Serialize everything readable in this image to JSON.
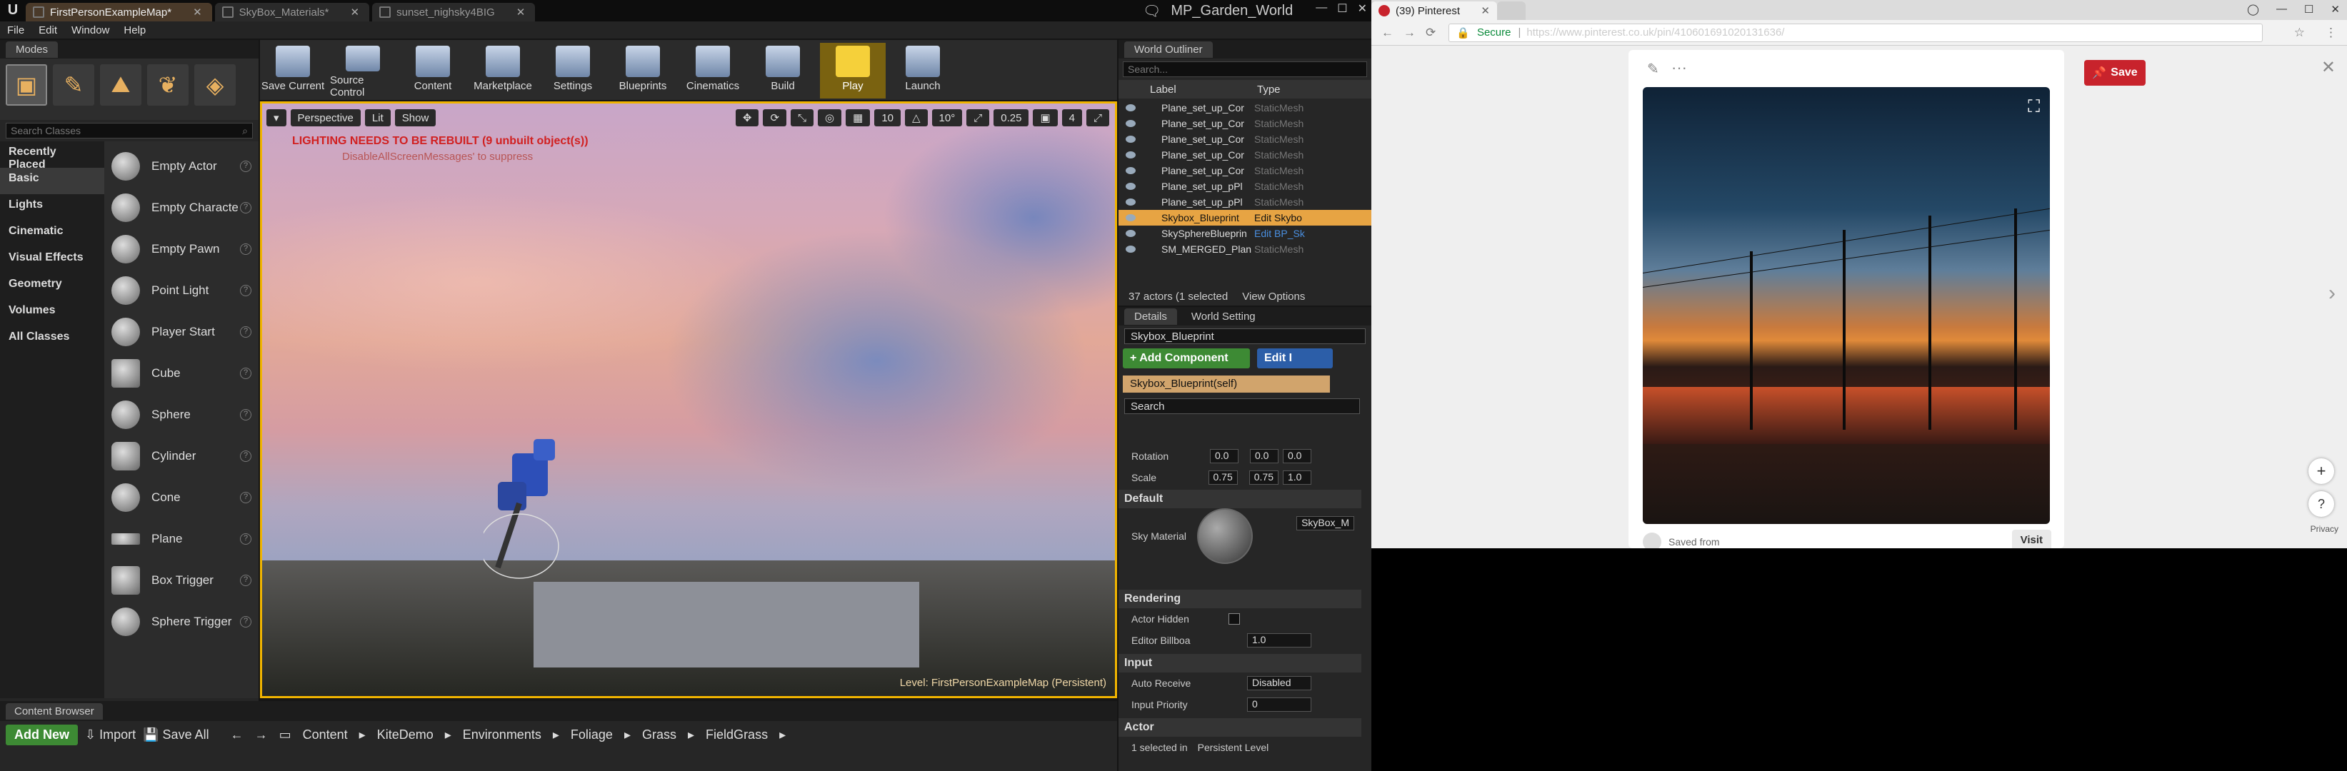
{
  "ue": {
    "tabs": [
      "FirstPersonExampleMap*",
      "SkyBox_Materials*",
      "sunset_nighsky4BIG"
    ],
    "project": "MP_Garden_World",
    "menu": [
      "File",
      "Edit",
      "Window",
      "Help"
    ],
    "modes": {
      "tab": "Modes",
      "search_placeholder": "Search Classes",
      "categories": [
        "Recently Placed",
        "Basic",
        "Lights",
        "Cinematic",
        "Visual Effects",
        "Geometry",
        "Volumes",
        "All Classes"
      ],
      "items": [
        "Empty Actor",
        "Empty Characte",
        "Empty Pawn",
        "Point Light",
        "Player Start",
        "Cube",
        "Sphere",
        "Cylinder",
        "Cone",
        "Plane",
        "Box Trigger",
        "Sphere Trigger"
      ]
    },
    "toolbar": [
      "Save Current",
      "Source Control",
      "Content",
      "Marketplace",
      "Settings",
      "Blueprints",
      "Cinematics",
      "Build",
      "Play",
      "Launch"
    ],
    "viewport": {
      "perspective": "Perspective",
      "lit": "Lit",
      "show": "Show",
      "snap1": "10",
      "snap2": "10°",
      "snap3": "0.25",
      "cam": "4",
      "warning": "LIGHTING NEEDS TO BE REBUILT (9 unbuilt object(s))",
      "warning_sub": "DisableAllScreenMessages' to suppress",
      "level_label": "Level:",
      "level_name": "FirstPersonExampleMap (Persistent)"
    },
    "outliner": {
      "tab": "World Outliner",
      "search_placeholder": "Search...",
      "col_label": "Label",
      "col_type": "Type",
      "rows": [
        {
          "name": "Plane_set_up_Cor",
          "type": "StaticMesh",
          "sel": false
        },
        {
          "name": "Plane_set_up_Cor",
          "type": "StaticMesh",
          "sel": false
        },
        {
          "name": "Plane_set_up_Cor",
          "type": "StaticMesh",
          "sel": false
        },
        {
          "name": "Plane_set_up_Cor",
          "type": "StaticMesh",
          "sel": false
        },
        {
          "name": "Plane_set_up_Cor",
          "type": "StaticMesh",
          "sel": false
        },
        {
          "name": "Plane_set_up_pPl",
          "type": "StaticMesh",
          "sel": false
        },
        {
          "name": "Plane_set_up_pPl",
          "type": "StaticMesh",
          "sel": false
        },
        {
          "name": "Skybox_Blueprint",
          "type": "Edit Skybo",
          "sel": true
        },
        {
          "name": "SkySphereBlueprin",
          "type": "Edit BP_Sk",
          "sel": false
        },
        {
          "name": "SM_MERGED_Plan",
          "type": "StaticMesh",
          "sel": false
        }
      ],
      "footer": "37 actors (1 selected",
      "view_options": "View Options"
    },
    "details": {
      "tab1": "Details",
      "tab2": "World Setting",
      "name": "Skybox_Blueprint",
      "add_component": "+ Add Component",
      "edit_bp": "Edit I",
      "search": "Search",
      "self": "Skybox_Blueprint(self)",
      "search2": "Search",
      "rotation_label": "Rotation",
      "rotation": [
        "0.0",
        "0.0",
        "0.0"
      ],
      "scale_label": "Scale",
      "scale": [
        "0.75",
        "0.75",
        "1.0"
      ],
      "sect_default": "Default",
      "sky_material": "Sky Material",
      "sky_mat_value": "SkyBox_M",
      "sect_rendering": "Rendering",
      "actor_hidden": "Actor Hidden",
      "editor_billboard": "Editor Billboa",
      "billboard_value": "1.0",
      "sect_input": "Input",
      "auto_receive": "Auto Receive",
      "auto_receive_value": "Disabled",
      "input_priority": "Input Priority",
      "input_priority_value": "0",
      "sect_actor": "Actor",
      "selected_in": "1 selected in",
      "persistent_level": "Persistent Level"
    },
    "content_browser": {
      "tab": "Content Browser",
      "add_new": "Add New",
      "import": "Import",
      "save_all": "Save All",
      "path": [
        "Content",
        "KiteDemo",
        "Environments",
        "Foliage",
        "Grass",
        "FieldGrass"
      ]
    }
  },
  "browser": {
    "tab_title": "(39) Pinterest",
    "secure": "Secure",
    "url": "https://www.pinterest.co.uk/pin/410601691020131636/",
    "save": "Save",
    "saved_from": "Saved from",
    "visit": "Visit",
    "privacy": "Privacy"
  }
}
